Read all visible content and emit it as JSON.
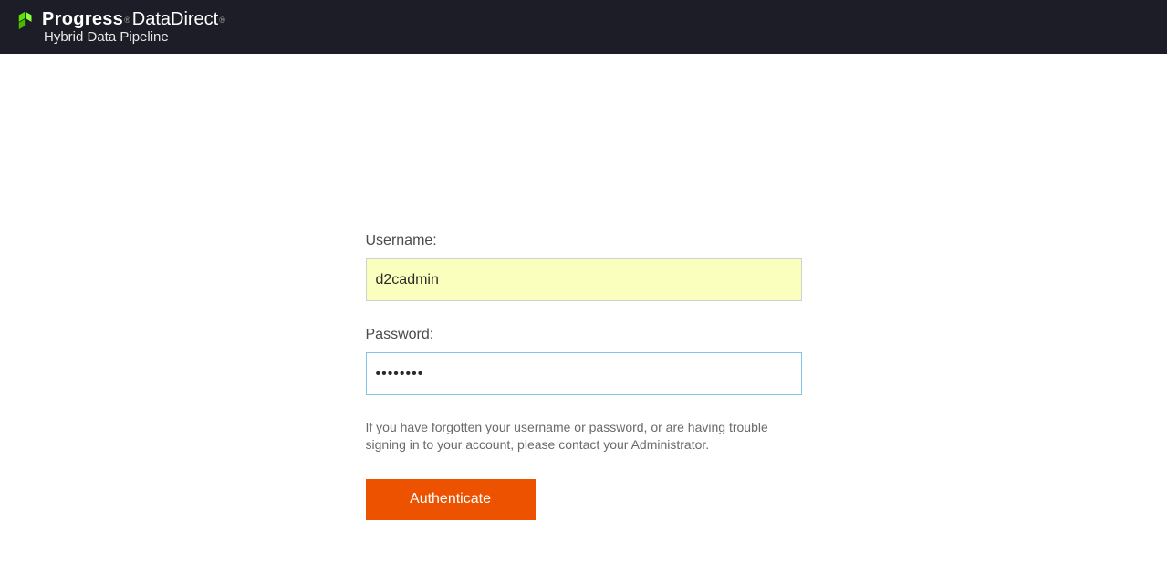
{
  "header": {
    "brand_primary": "Progress",
    "brand_secondary": "DataDirect",
    "brand_sub": "Hybrid Data Pipeline"
  },
  "form": {
    "username_label": "Username:",
    "username_value": "d2cadmin",
    "password_label": "Password:",
    "password_value": "••••••••",
    "help_text": "If you have forgotten your username or password, or are having trouble signing in to your account, please contact your Administrator.",
    "submit_label": "Authenticate"
  }
}
